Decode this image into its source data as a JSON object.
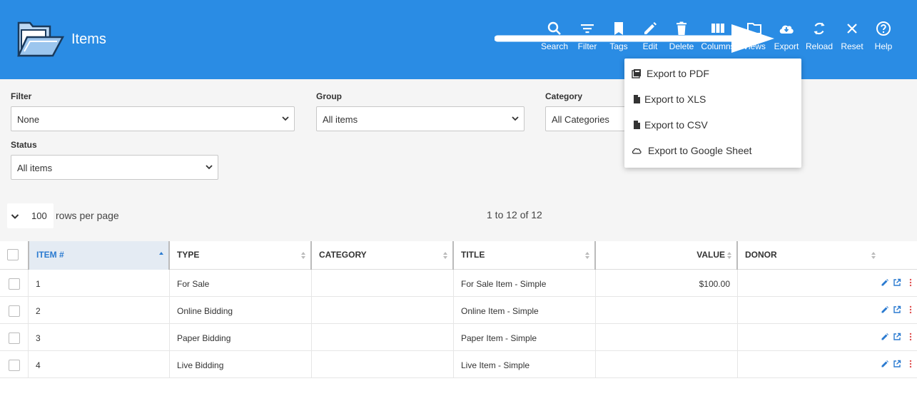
{
  "header": {
    "title": "Items",
    "background": "#2a8ce4",
    "toolbar": [
      {
        "id": "search",
        "label": "Search",
        "icon": "search-icon"
      },
      {
        "id": "filter",
        "label": "Filter",
        "icon": "filter-icon"
      },
      {
        "id": "tags",
        "label": "Tags",
        "icon": "bookmark-icon"
      },
      {
        "id": "edit",
        "label": "Edit",
        "icon": "pencil-icon"
      },
      {
        "id": "delete",
        "label": "Delete",
        "icon": "trash-icon"
      },
      {
        "id": "columns",
        "label": "Columns",
        "icon": "columns-icon"
      },
      {
        "id": "views",
        "label": "Views",
        "icon": "folder-icon"
      },
      {
        "id": "export",
        "label": "Export",
        "icon": "cloud-download-icon"
      },
      {
        "id": "reload",
        "label": "Reload",
        "icon": "reload-icon"
      },
      {
        "id": "reset",
        "label": "Reset",
        "icon": "close-icon"
      },
      {
        "id": "help",
        "label": "Help",
        "icon": "help-circle-icon"
      }
    ]
  },
  "export_menu": {
    "items": [
      {
        "label": "Export to PDF",
        "icon": "pdf-icon"
      },
      {
        "label": "Export to XLS",
        "icon": "document-icon"
      },
      {
        "label": "Export to CSV",
        "icon": "document-icon"
      },
      {
        "label": "Export to Google Sheet",
        "icon": "cloud-icon"
      }
    ]
  },
  "filters": {
    "filter": {
      "label": "Filter",
      "value": "None"
    },
    "group": {
      "label": "Group",
      "value": "All items"
    },
    "category": {
      "label": "Category",
      "value": "All Categories"
    },
    "status": {
      "label": "Status",
      "value": "All items"
    }
  },
  "pagination": {
    "rows_per_page": "100",
    "rows_label": "rows per page",
    "range": "1 to 12 of 12"
  },
  "table": {
    "columns": [
      "ITEM #",
      "TYPE",
      "CATEGORY",
      "TITLE",
      "VALUE",
      "DONOR"
    ],
    "rows": [
      {
        "item": "1",
        "type": "For Sale",
        "category": "",
        "title": "For Sale Item - Simple",
        "value": "$100.00",
        "donor": ""
      },
      {
        "item": "2",
        "type": "Online Bidding",
        "category": "",
        "title": "Online Item - Simple",
        "value": "",
        "donor": ""
      },
      {
        "item": "3",
        "type": "Paper Bidding",
        "category": "",
        "title": "Paper Item - Simple",
        "value": "",
        "donor": ""
      },
      {
        "item": "4",
        "type": "Live Bidding",
        "category": "",
        "title": "Live Item - Simple",
        "value": "",
        "donor": ""
      }
    ]
  },
  "colors": {
    "accent": "#2a8ce4",
    "link": "#2a7ad0",
    "more": "#e05050"
  }
}
